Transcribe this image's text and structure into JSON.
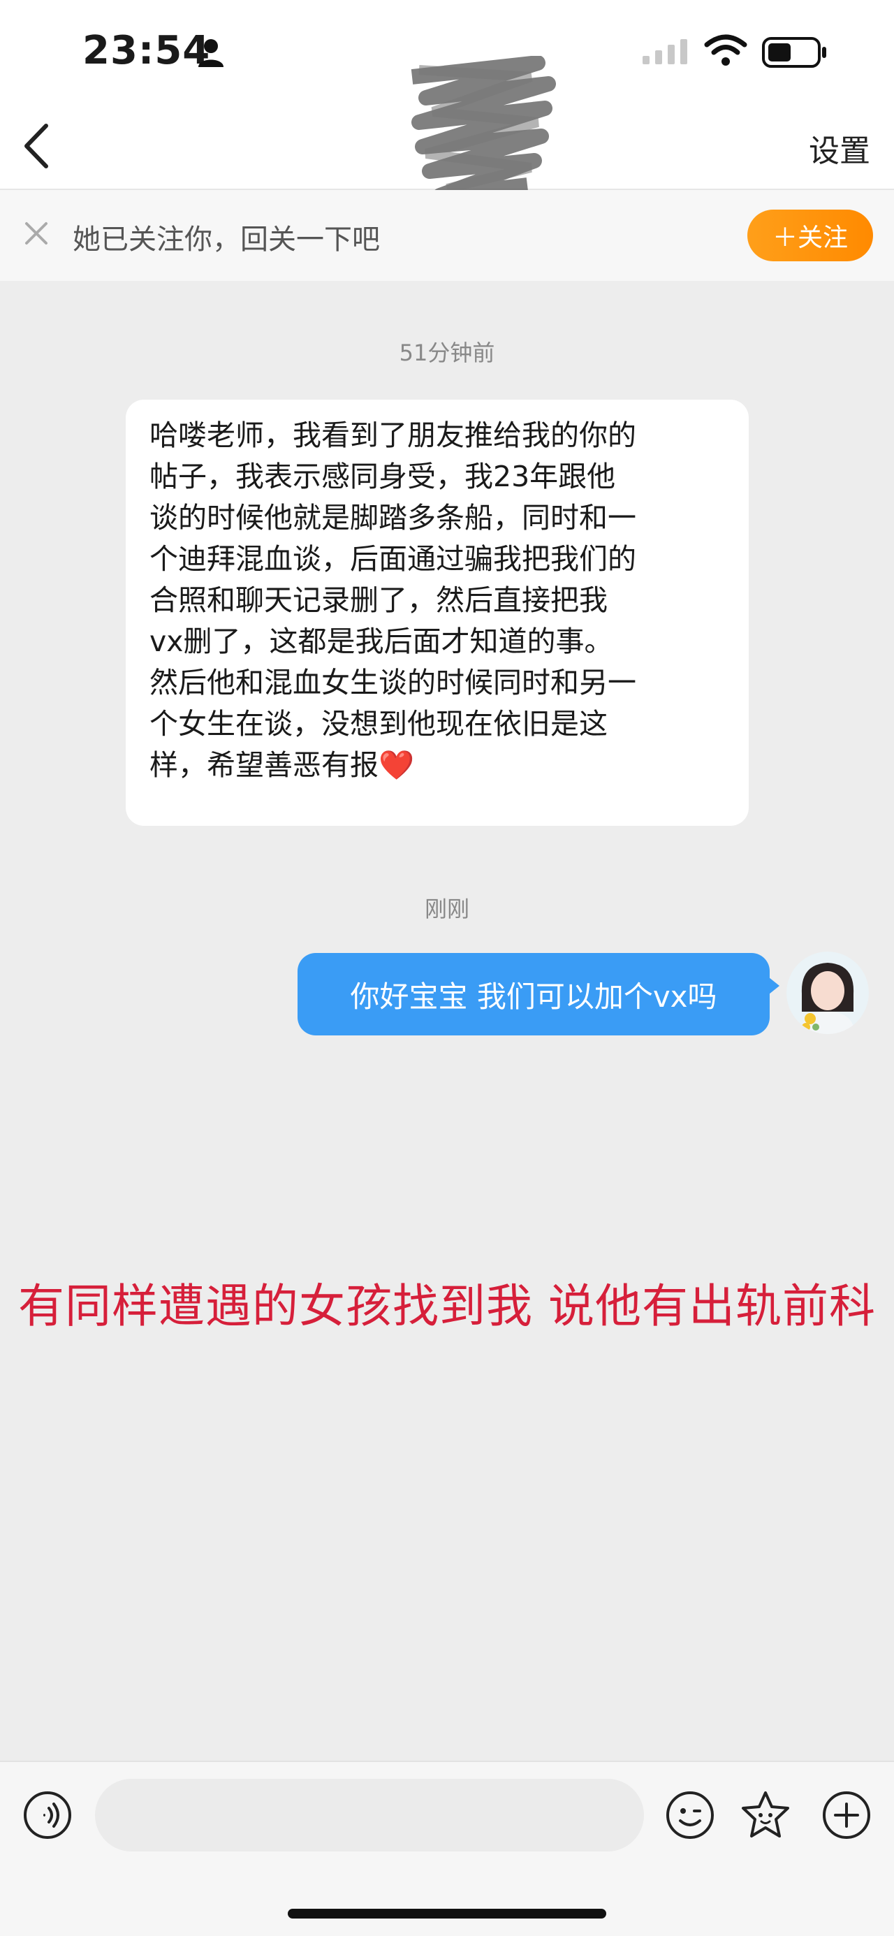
{
  "status_bar": {
    "time": "23:54",
    "icons": [
      "person-icon",
      "signal-icon",
      "wifi-icon",
      "battery-icon"
    ]
  },
  "header": {
    "back_icon": "chevron-left-icon",
    "settings_label": "设置"
  },
  "follow_banner": {
    "close_icon": "close-icon",
    "text": "她已关注你，回关一下吧",
    "button_label": "＋关注",
    "accent_color": "#ff9500"
  },
  "messages": [
    {
      "timestamp": "51分钟前",
      "side": "left",
      "lines": [
        "哈喽老师，我看到了朋友推给我的你的",
        "帖子，我表示感同身受，我23年跟他",
        "谈的时候他就是脚踏多条船，同时和一",
        "个迪拜混血谈，后面通过骗我把我们的",
        "合照和聊天记录删了，然后直接把我",
        "vx删了，这都是我后面才知道的事。",
        "然后他和混血女生谈的时候同时和另一",
        "个女生在谈，没想到他现在依旧是这",
        "样，希望善恶有报"
      ],
      "trailing_emoji": "❤️"
    },
    {
      "timestamp": "刚刚",
      "side": "right",
      "text": "你好宝宝 我们可以加个vx吗",
      "bubble_color": "#3a9cf5"
    }
  ],
  "caption": {
    "text": "有同样遭遇的女孩找到我 说他有出轨前科",
    "color": "#d61f3a"
  },
  "input_bar": {
    "voice_icon": "voice-icon",
    "placeholder": "",
    "emoji_icon": "emoji-icon",
    "sticker_icon": "sticker-icon",
    "plus_icon": "plus-icon"
  }
}
